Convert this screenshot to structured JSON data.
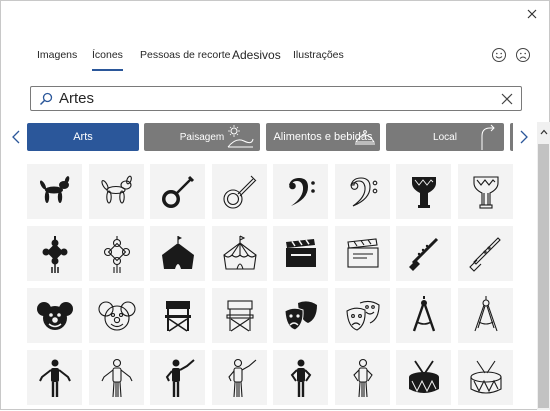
{
  "dialog": {
    "tabs": [
      {
        "label": "Imagens"
      },
      {
        "label": "Ícones"
      },
      {
        "label": "Pessoas de recorte"
      },
      {
        "label": "Adesivos"
      },
      {
        "label": "Ilustrações"
      }
    ],
    "active_tab": "Ícones"
  },
  "search": {
    "value": "Artes"
  },
  "categories": [
    {
      "label": "Arts",
      "selected": true
    },
    {
      "label": "Paisagem"
    },
    {
      "label": "Alimentos e bebidas"
    },
    {
      "label": "Local"
    }
  ],
  "colors": {
    "accent": "#2b579a",
    "category_grey": "#7a7a7a",
    "tile_bg": "#f3f3f3"
  },
  "icons": [
    [
      "balloon-dog-icon",
      "balloon-dog-outline-icon",
      "banjo-icon",
      "banjo-outline-icon",
      "bass-clef-icon",
      "bass-clef-outline-icon",
      "djembe-icon",
      "djembe-outline-icon"
    ],
    [
      "chinese-knot-icon",
      "chinese-knot-outline-icon",
      "circus-tent-icon",
      "circus-tent-outline-icon",
      "clapperboard-icon",
      "clapperboard-outline-icon",
      "clarinet-icon",
      "clarinet-outline-icon"
    ],
    [
      "clown-face-icon",
      "clown-face-outline-icon",
      "director-chair-icon",
      "director-chair-outline-icon",
      "theater-masks-icon",
      "theater-masks-outline-icon",
      "drafting-compass-icon",
      "drafting-compass-outline-icon"
    ],
    [
      "mannequin-icon",
      "mannequin-outline-icon",
      "conductor-icon",
      "conductor-outline-icon",
      "mannequin-pose-icon",
      "mannequin-pose-outline-icon",
      "snare-drum-icon",
      "snare-drum-outline-icon"
    ]
  ]
}
